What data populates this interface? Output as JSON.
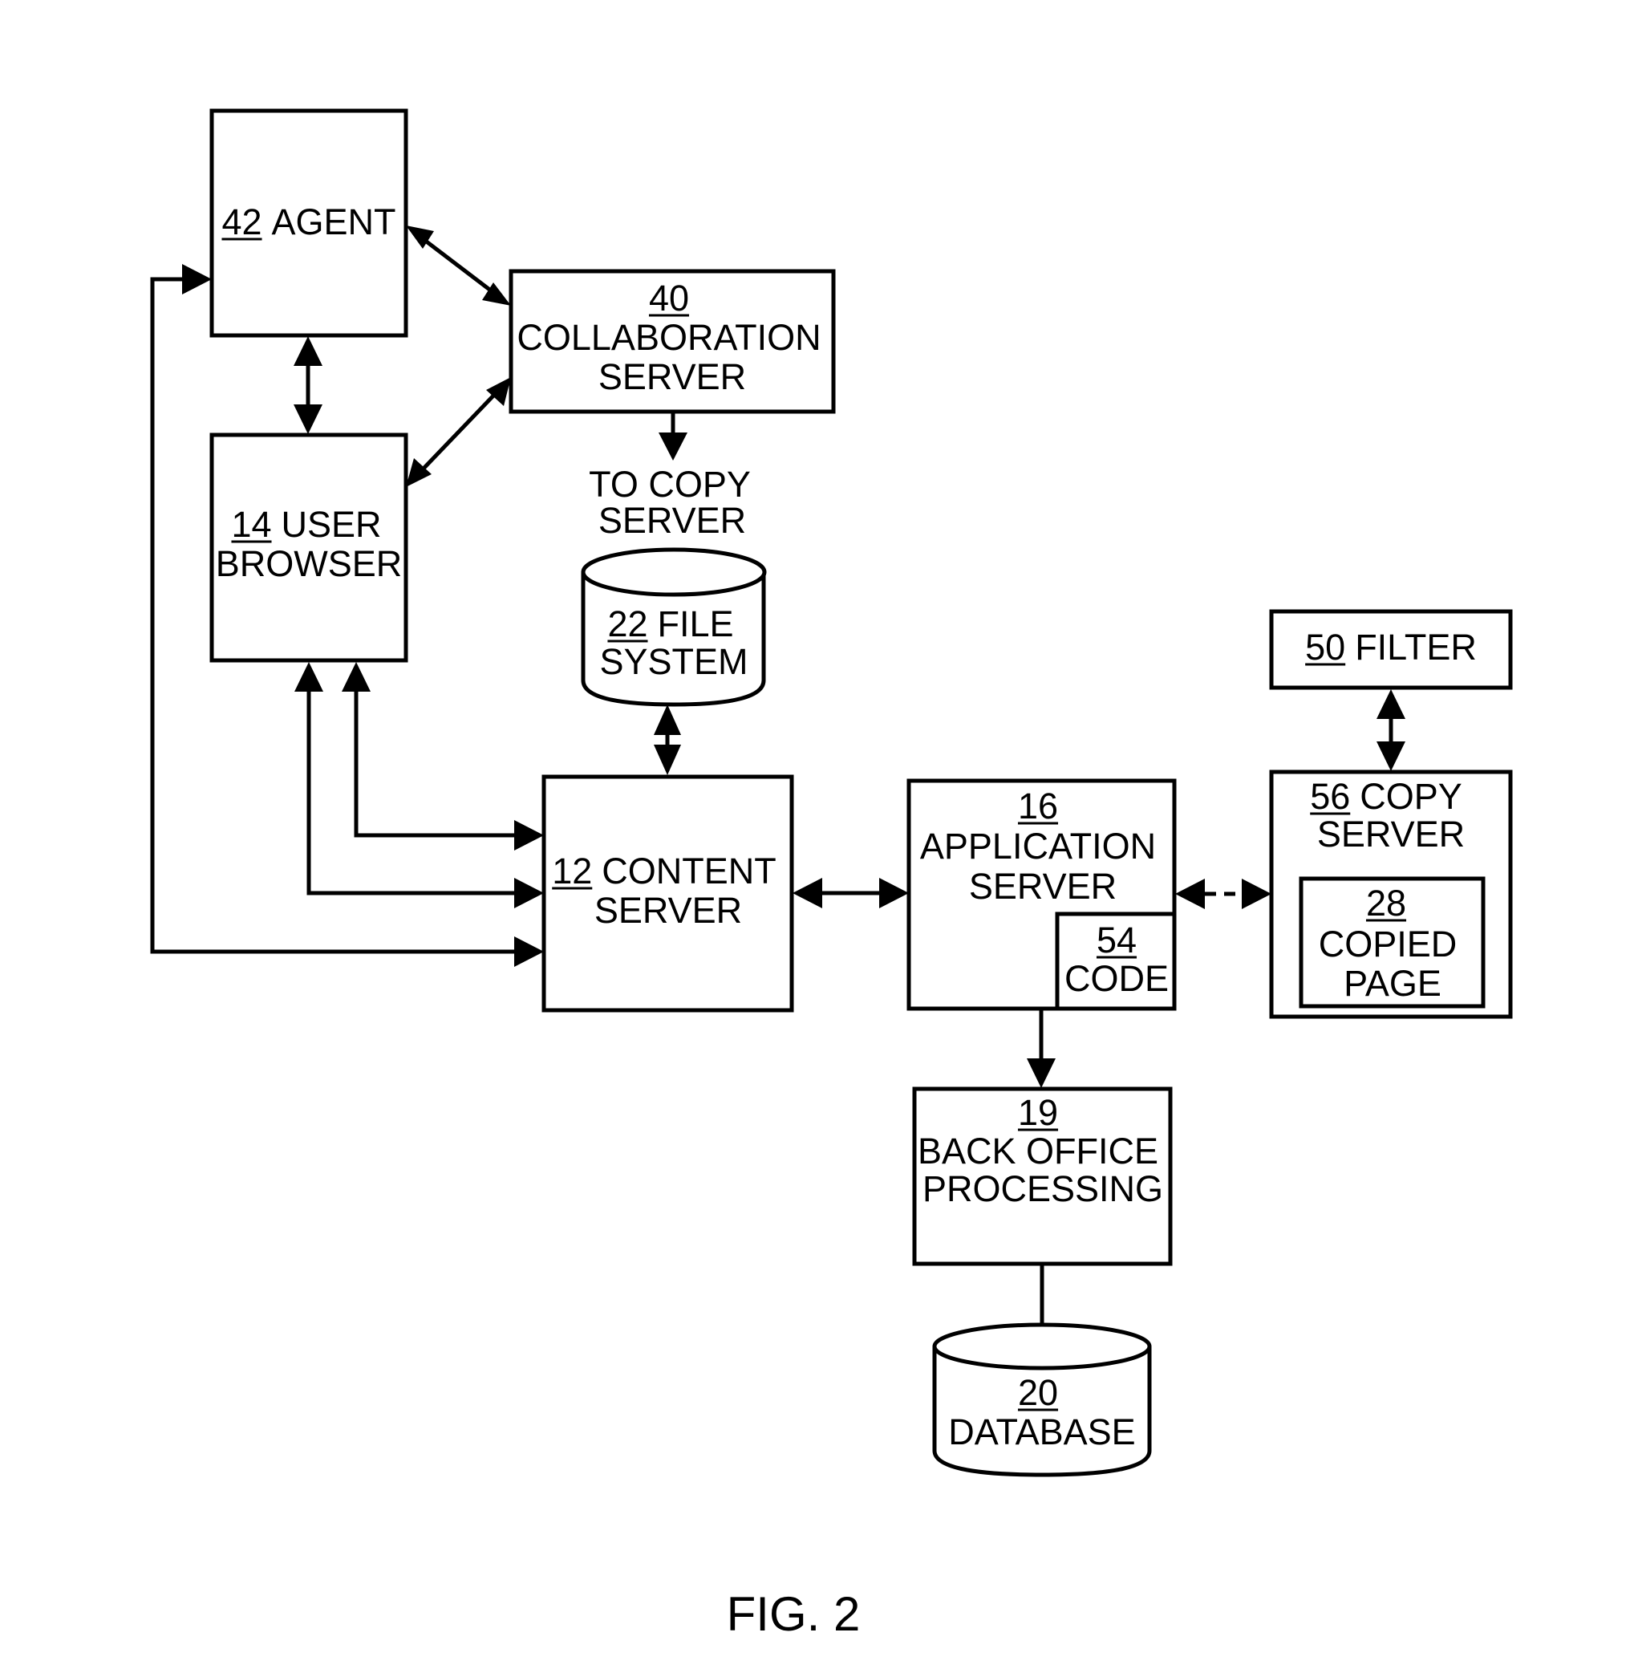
{
  "figure": {
    "caption": "FIG. 2"
  },
  "nodes": {
    "agent": {
      "number": "42",
      "lines": [
        "AGENT"
      ]
    },
    "collaboration_server": {
      "number": "40",
      "lines": [
        "COLLABORATION",
        "SERVER"
      ]
    },
    "user_browser": {
      "number": "14",
      "lines": [
        "USER",
        "BROWSER"
      ]
    },
    "file_system": {
      "number": "22",
      "lines": [
        "FILE",
        "SYSTEM"
      ]
    },
    "content_server": {
      "number": "12",
      "lines": [
        "CONTENT",
        "SERVER"
      ]
    },
    "application_server": {
      "number": "16",
      "lines": [
        "APPLICATION",
        "SERVER"
      ]
    },
    "code": {
      "number": "54",
      "lines": [
        "CODE"
      ]
    },
    "filter": {
      "number": "50",
      "lines": [
        "FILTER"
      ]
    },
    "copy_server": {
      "number": "56",
      "lines": [
        "COPY",
        "SERVER"
      ]
    },
    "copied_page": {
      "number": "28",
      "lines": [
        "COPIED",
        "PAGE"
      ]
    },
    "back_office": {
      "number": "19",
      "lines": [
        "BACK OFFICE",
        "PROCESSING"
      ]
    },
    "database": {
      "number": "20",
      "lines": [
        "DATABASE"
      ]
    }
  },
  "annotations": {
    "to_copy_server": [
      "TO COPY",
      "SERVER"
    ]
  },
  "edges": [
    {
      "from": "agent",
      "to": "collaboration_server",
      "type": "bidirectional"
    },
    {
      "from": "agent",
      "to": "user_browser",
      "type": "bidirectional"
    },
    {
      "from": "collaboration_server",
      "to": "user_browser",
      "type": "bidirectional"
    },
    {
      "from": "collaboration_server",
      "to": "to_copy_server",
      "type": "directed"
    },
    {
      "from": "file_system",
      "to": "content_server",
      "type": "bidirectional"
    },
    {
      "from": "content_server",
      "to": "user_browser",
      "type": "directed"
    },
    {
      "from": "user_browser",
      "to": "content_server",
      "type": "directed"
    },
    {
      "from": "agent",
      "to": "content_server",
      "type": "directed-loop"
    },
    {
      "from": "content_server",
      "to": "application_server",
      "type": "bidirectional"
    },
    {
      "from": "application_server",
      "to": "copy_server",
      "type": "bidirectional-dashed"
    },
    {
      "from": "filter",
      "to": "copy_server",
      "type": "bidirectional"
    },
    {
      "from": "application_server",
      "to": "back_office",
      "type": "directed"
    },
    {
      "from": "back_office",
      "to": "database",
      "type": "undirected"
    }
  ]
}
